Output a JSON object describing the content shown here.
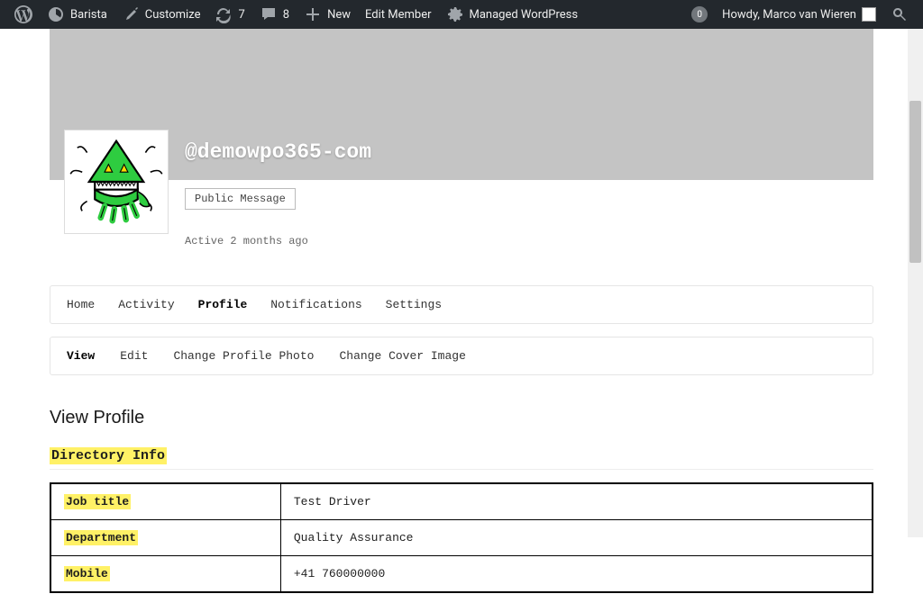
{
  "adminbar": {
    "site_name": "Barista",
    "customize": "Customize",
    "updates_count": "7",
    "comments_count": "8",
    "new_label": "New",
    "edit_member": "Edit Member",
    "managed_wp": "Managed WordPress",
    "notifications_count": "0",
    "howdy": "Howdy, Marco van Wieren"
  },
  "profile": {
    "username": "@demowpo365-com",
    "public_message_btn": "Public Message",
    "activity": "Active 2 months ago"
  },
  "primary_nav": [
    "Home",
    "Activity",
    "Profile",
    "Notifications",
    "Settings"
  ],
  "primary_nav_selected": 2,
  "sub_nav": [
    "View",
    "Edit",
    "Change Profile Photo",
    "Change Cover Image"
  ],
  "sub_nav_selected": 0,
  "view_title": "View Profile",
  "directory_heading": "Directory Info",
  "directory_rows": [
    {
      "label": "Job title",
      "value": "Test Driver"
    },
    {
      "label": "Department",
      "value": "Quality Assurance"
    },
    {
      "label": "Mobile",
      "value": "+41 760000000"
    }
  ]
}
